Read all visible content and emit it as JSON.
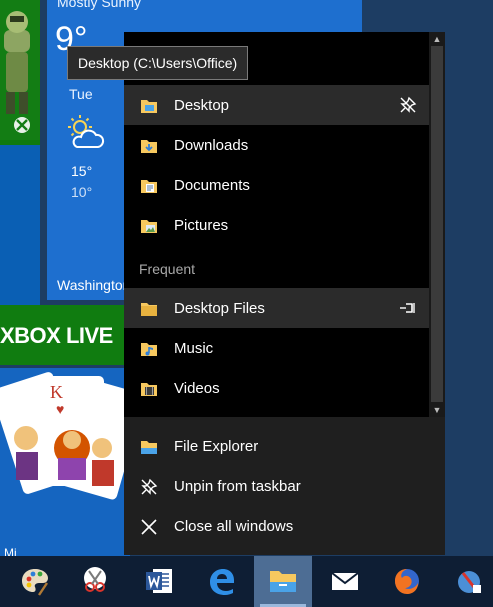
{
  "tooltip": {
    "text": "Desktop (C:\\Users\\Office)"
  },
  "weather_tile": {
    "condition": "Mostly Sunny",
    "temperature": "9°",
    "day": "Tue",
    "high": "15°",
    "low": "10°",
    "city": "Washington"
  },
  "xbox_tile": {
    "label": "XBOX LIVE"
  },
  "solitaire_tile": {
    "label": "Mi"
  },
  "jumplist": {
    "pinned": [
      {
        "label": "Desktop",
        "icon": "folder-desktop-icon",
        "pinned": true
      },
      {
        "label": "Downloads",
        "icon": "folder-downloads-icon"
      },
      {
        "label": "Documents",
        "icon": "folder-documents-icon"
      },
      {
        "label": "Pictures",
        "icon": "folder-pictures-icon"
      }
    ],
    "frequent_heading": "Frequent",
    "frequent": [
      {
        "label": "Desktop Files",
        "icon": "folder-icon",
        "pin_available": true
      },
      {
        "label": "Music",
        "icon": "folder-music-icon"
      },
      {
        "label": "Videos",
        "icon": "folder-videos-icon"
      }
    ],
    "tasks": [
      {
        "label": "File Explorer",
        "icon": "file-explorer-icon"
      },
      {
        "label": "Unpin from taskbar",
        "icon": "unpin-icon"
      },
      {
        "label": "Close all windows",
        "icon": "close-icon"
      }
    ]
  },
  "taskbar": {
    "apps": [
      {
        "name": "paint",
        "icon": "paint-palette-icon"
      },
      {
        "name": "snipping-tool",
        "icon": "snipping-tool-icon"
      },
      {
        "name": "word",
        "icon": "word-icon"
      },
      {
        "name": "edge",
        "icon": "edge-icon"
      },
      {
        "name": "file-explorer",
        "icon": "file-explorer-icon",
        "active": true
      },
      {
        "name": "mail",
        "icon": "mail-icon"
      },
      {
        "name": "firefox",
        "icon": "firefox-icon"
      },
      {
        "name": "other",
        "icon": "app-icon"
      }
    ]
  },
  "colors": {
    "accent": "#1e6fcf",
    "xbox_green": "#107c10",
    "jumplist_bg": "#1f1f1f",
    "taskbar_bg": "#0e1e34",
    "folder_yellow": "#f6c85f"
  }
}
